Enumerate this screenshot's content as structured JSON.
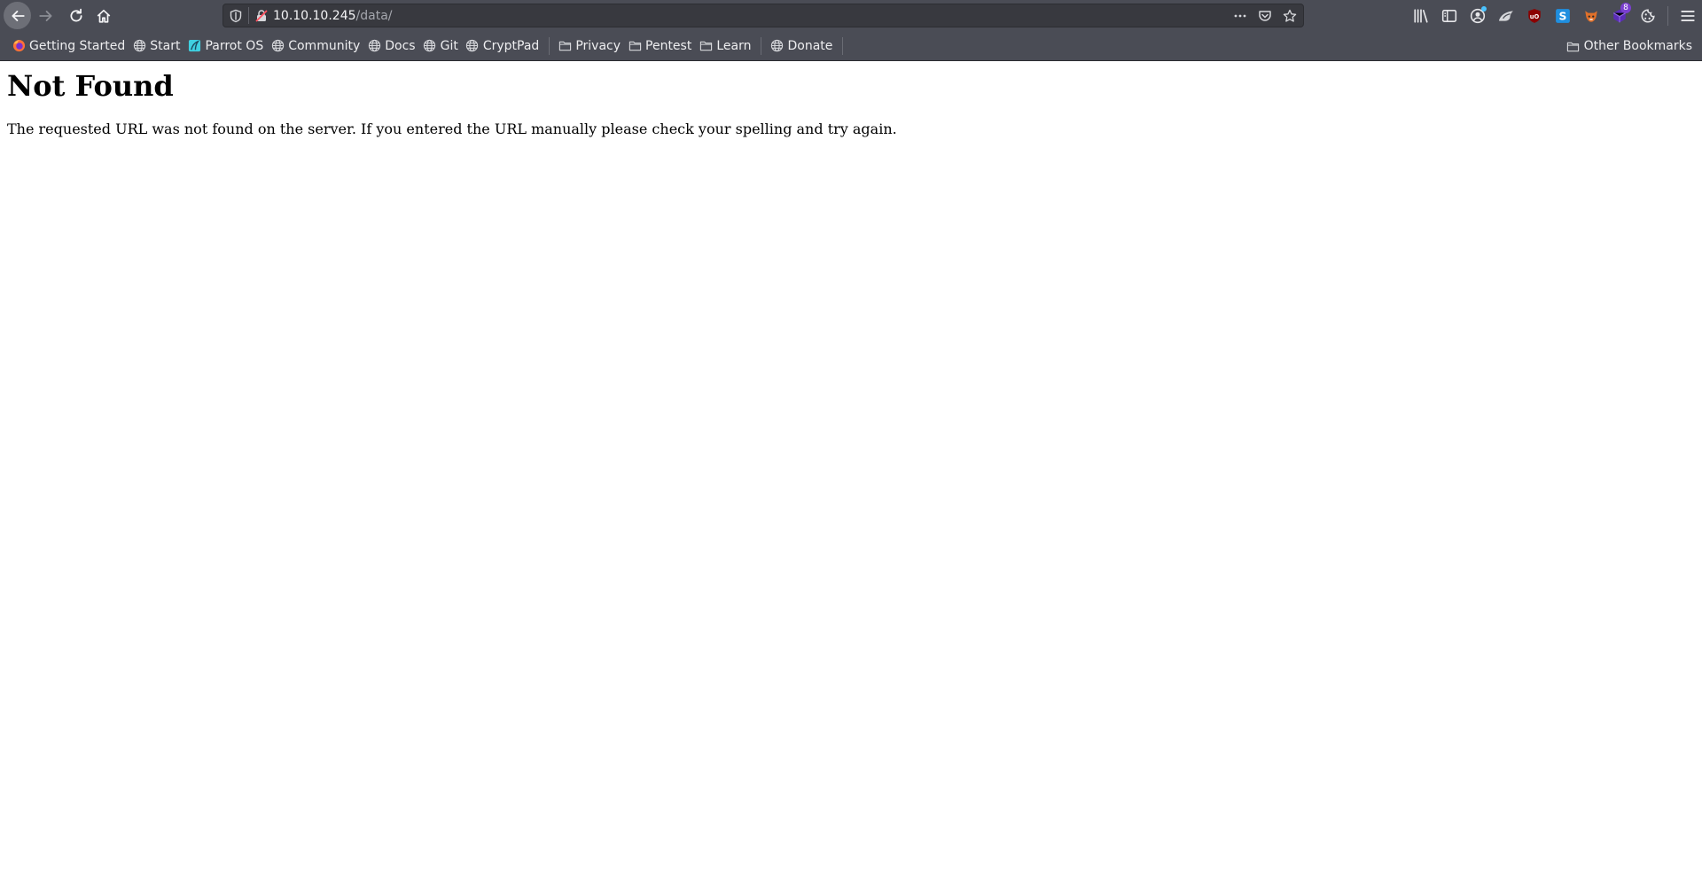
{
  "toolbar": {
    "url": {
      "host": "10.10.10.245",
      "path": "/data/"
    },
    "extension_badge": "8"
  },
  "bookmarks": {
    "items": [
      {
        "label": "Getting Started",
        "icon": "firefox-icon"
      },
      {
        "label": "Start",
        "icon": "globe-icon"
      },
      {
        "label": "Parrot OS",
        "icon": "parrot-icon"
      },
      {
        "label": "Community",
        "icon": "globe-icon"
      },
      {
        "label": "Docs",
        "icon": "globe-icon"
      },
      {
        "label": "Git",
        "icon": "globe-icon"
      },
      {
        "label": "CryptPad",
        "icon": "globe-icon"
      },
      {
        "label": "Privacy",
        "icon": "folder-icon"
      },
      {
        "label": "Pentest",
        "icon": "folder-icon"
      },
      {
        "label": "Learn",
        "icon": "folder-icon"
      },
      {
        "label": "Donate",
        "icon": "globe-icon"
      }
    ],
    "other": "Other Bookmarks"
  },
  "page": {
    "title": "Not Found",
    "message": "The requested URL was not found on the server. If you entered the URL manually please check your spelling and try again."
  },
  "colors": {
    "chrome": "#4a4c55",
    "urlbar": "#38393f",
    "page_bg": "#ffffff"
  }
}
